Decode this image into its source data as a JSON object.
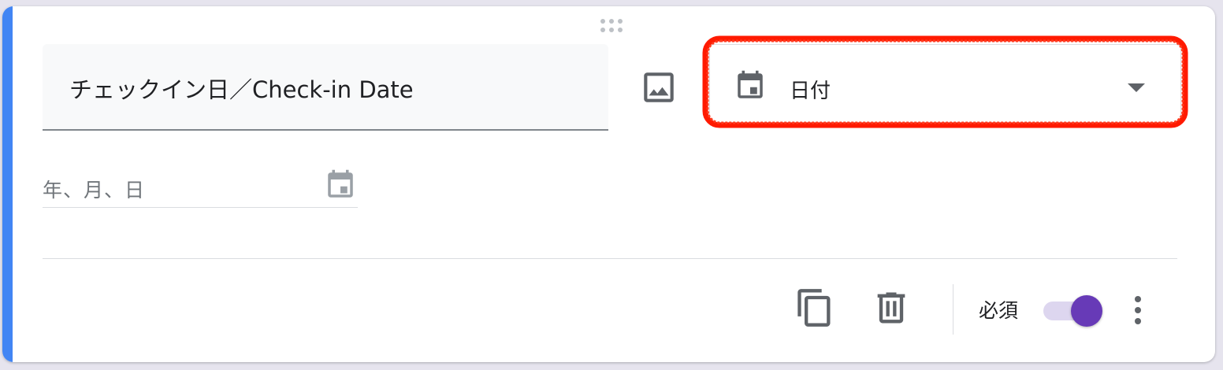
{
  "question": {
    "title": "チェックイン日／Check-in Date",
    "type_selected": "日付",
    "date_placeholder": "年、月、日",
    "required_label": "必須",
    "required_on": true
  },
  "icons": {
    "drag": "drag-handle-icon",
    "image": "image-icon",
    "type": "calendar-icon",
    "dropdown": "arrow-drop-down-icon",
    "date_picker": "calendar-icon",
    "copy": "copy-icon",
    "delete": "trash-icon",
    "more": "more-vert-icon"
  },
  "colors": {
    "accent": "#4285f4",
    "toggle_on": "#673ab7",
    "highlight": "#ff1a00"
  }
}
